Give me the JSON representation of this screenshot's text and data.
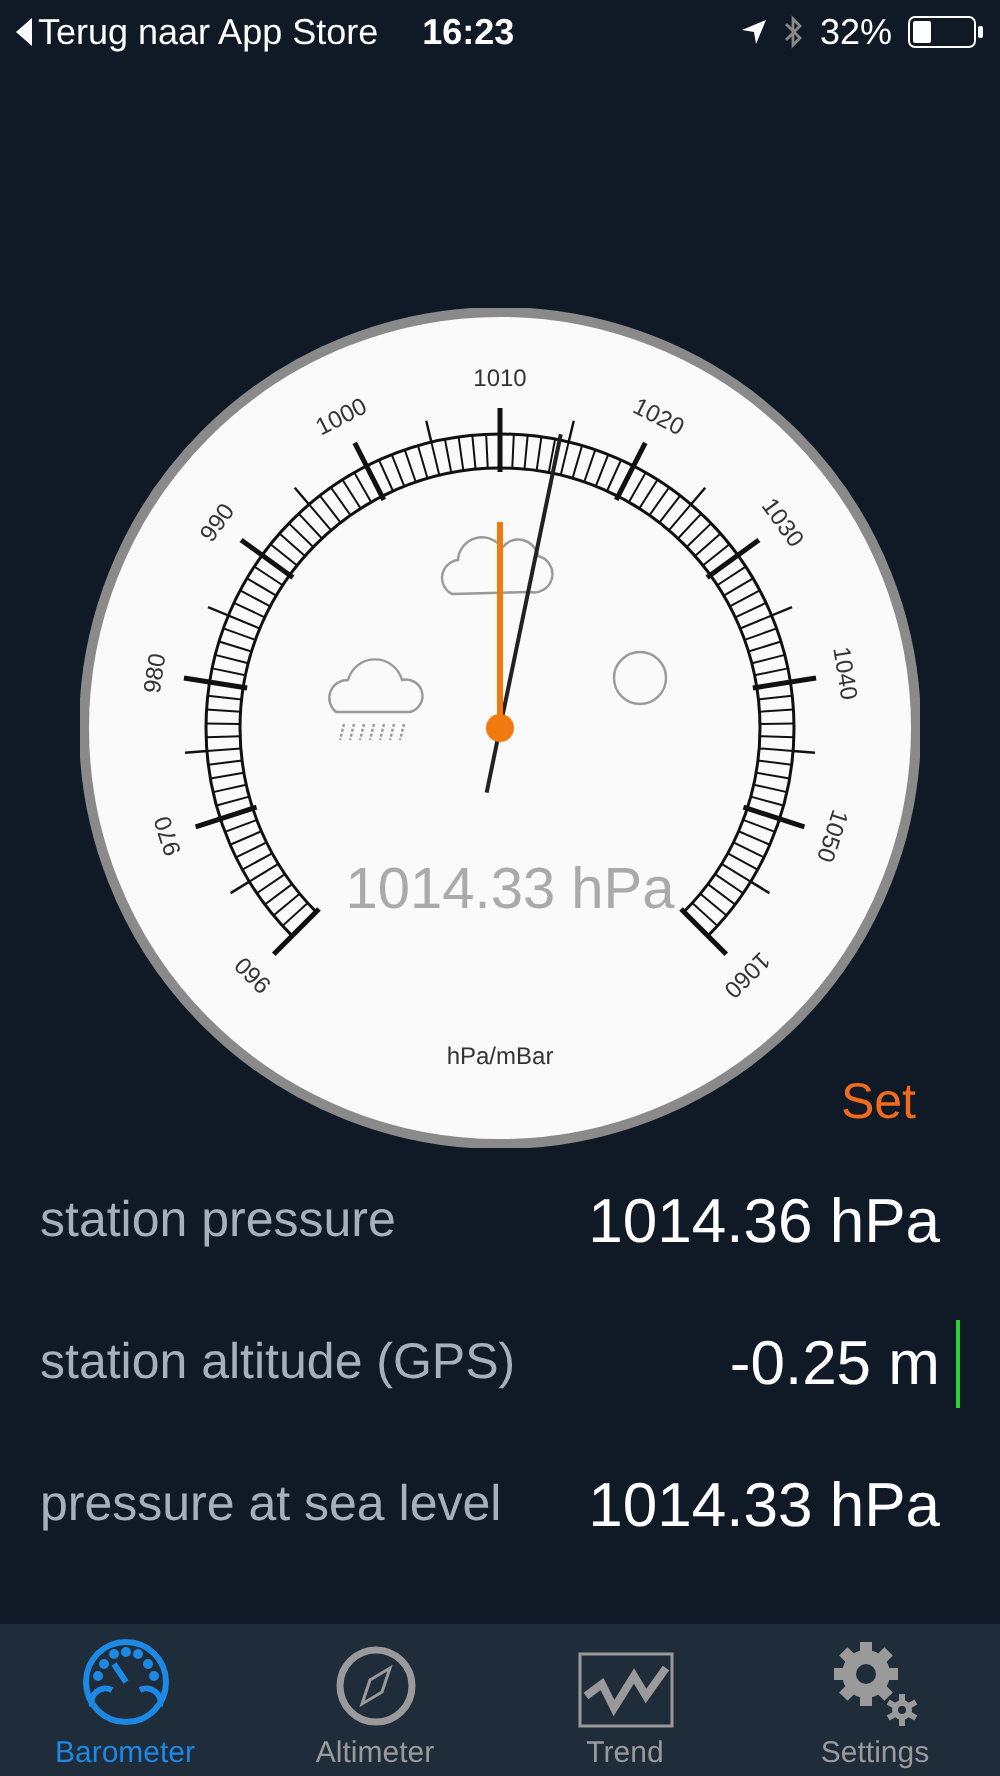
{
  "status_bar": {
    "back_label": "Terug naar App Store",
    "time": "16:23",
    "battery": "32%"
  },
  "gauge": {
    "scale_labels": [
      "960",
      "970",
      "980",
      "990",
      "1000",
      "1010",
      "1020",
      "1030",
      "1040",
      "1050",
      "1060"
    ],
    "reading": "1014.33 hPa",
    "unit": "hPa/mBar"
  },
  "set_button": "Set",
  "readings": [
    {
      "label": "station pressure",
      "value": "1014.36 hPa",
      "editing": false
    },
    {
      "label": "station altitude (GPS)",
      "value": "-0.25 m",
      "editing": true
    },
    {
      "label": "pressure at sea level",
      "value": "1014.33 hPa",
      "editing": false
    }
  ],
  "tabs": [
    {
      "label": "Barometer",
      "kind": "barometer",
      "selected": true
    },
    {
      "label": "Altimeter",
      "kind": "compass",
      "selected": false
    },
    {
      "label": "Trend",
      "kind": "trend",
      "selected": false
    },
    {
      "label": "Settings",
      "kind": "settings",
      "selected": false
    }
  ]
}
